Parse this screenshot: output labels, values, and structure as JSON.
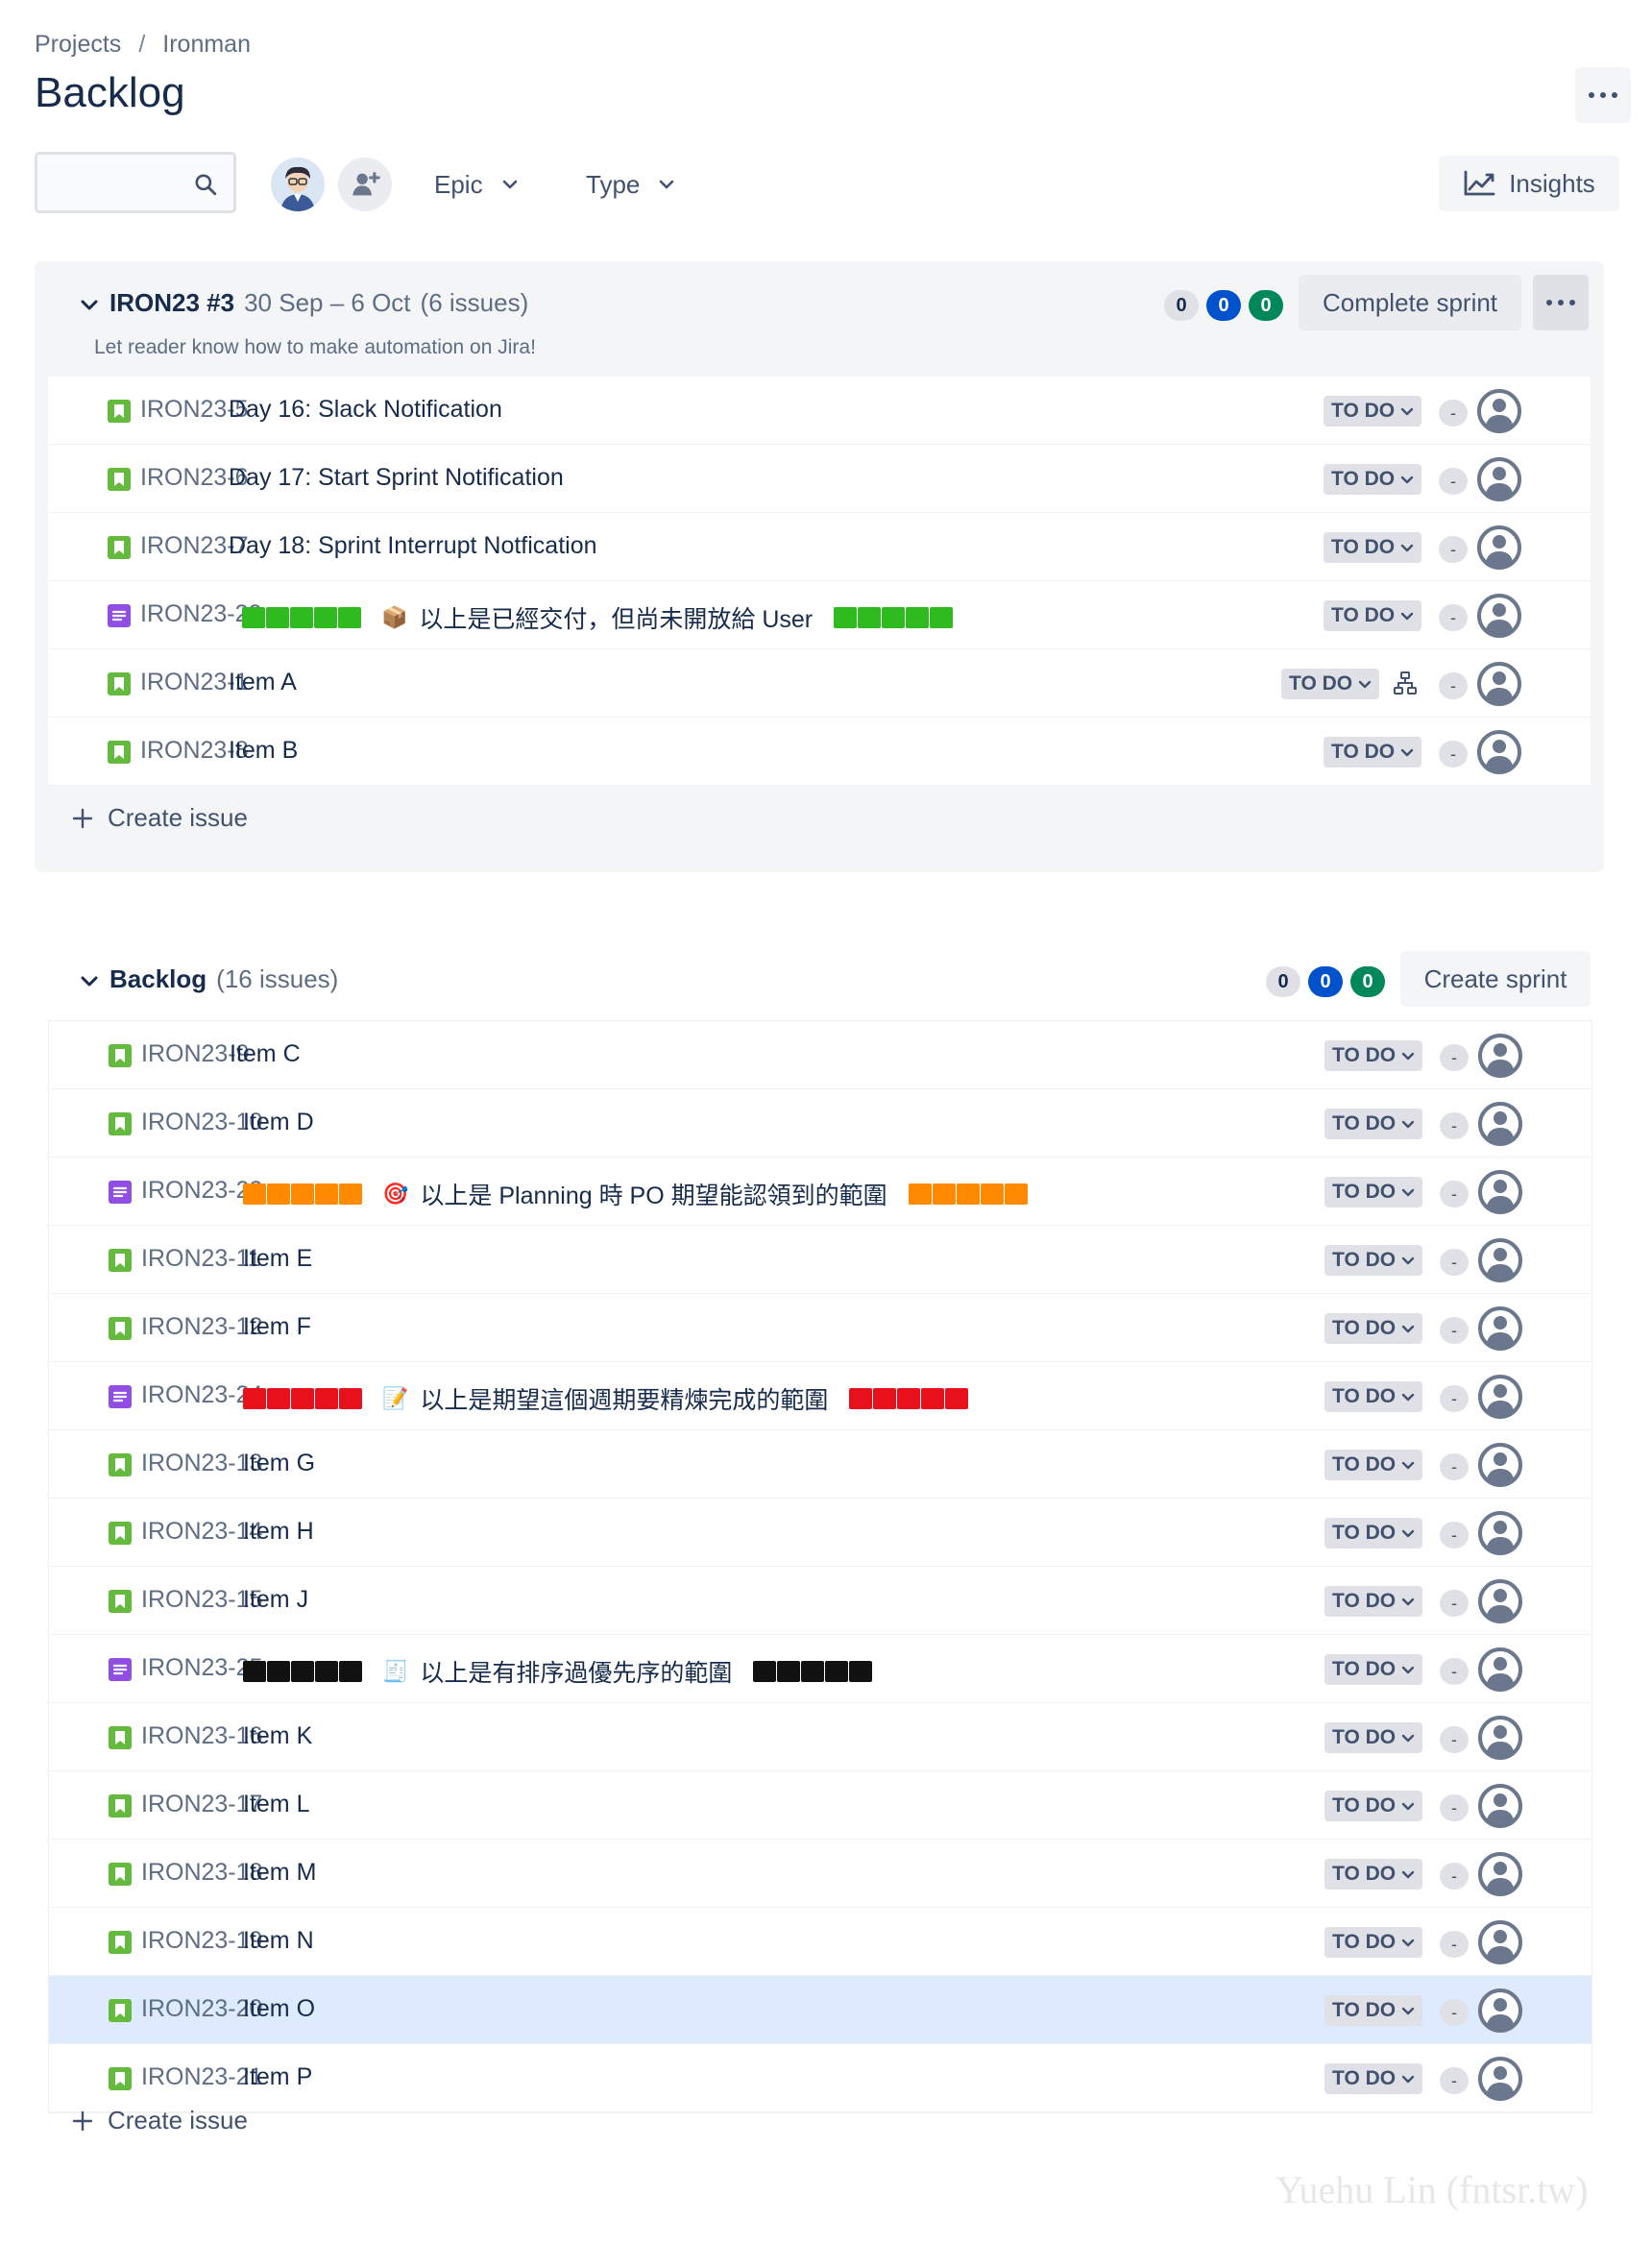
{
  "breadcrumb": {
    "projects": "Projects",
    "separator": "/",
    "project": "Ironman"
  },
  "page": {
    "title": "Backlog"
  },
  "toolbar": {
    "search_placeholder": "",
    "epic_label": "Epic",
    "type_label": "Type",
    "insights_label": "Insights"
  },
  "sprint": {
    "name": "IRON23 #3",
    "dates": "30 Sep – 6 Oct",
    "issue_count": "(6 issues)",
    "goal": "Let reader know how to make automation on Jira!",
    "counts": {
      "todo": "0",
      "in_progress": "0",
      "done": "0"
    },
    "action_label": "Complete sprint",
    "create_label": "Create issue",
    "issues": [
      {
        "key": "IRON23-5",
        "summary": "Day 16: Slack Notification",
        "type": "story",
        "status": "TO DO",
        "estimate": "-"
      },
      {
        "key": "IRON23-6",
        "summary": "Day 17: Start Sprint Notification",
        "type": "story",
        "status": "TO DO",
        "estimate": "-"
      },
      {
        "key": "IRON23-7",
        "summary": "Day 18: Sprint Interrupt Notfication",
        "type": "story",
        "status": "TO DO",
        "estimate": "-"
      },
      {
        "key": "IRON23-22",
        "summary": "以上是已經交付，但尚未開放給 User",
        "type": "task",
        "status": "TO DO",
        "estimate": "-",
        "divider_color": "#2fba1f",
        "glyph": "📦"
      },
      {
        "key": "IRON23-1",
        "summary": "Item A",
        "type": "story",
        "status": "TO DO",
        "estimate": "-",
        "has_children": true
      },
      {
        "key": "IRON23-8",
        "summary": "Item B",
        "type": "story",
        "status": "TO DO",
        "estimate": "-"
      }
    ]
  },
  "backlog": {
    "name": "Backlog",
    "issue_count": "(16 issues)",
    "counts": {
      "todo": "0",
      "in_progress": "0",
      "done": "0"
    },
    "action_label": "Create sprint",
    "create_label": "Create issue",
    "issues": [
      {
        "key": "IRON23-9",
        "summary": "Item C",
        "type": "story",
        "status": "TO DO",
        "estimate": "-"
      },
      {
        "key": "IRON23-10",
        "summary": "Item D",
        "type": "story",
        "status": "TO DO",
        "estimate": "-"
      },
      {
        "key": "IRON23-23",
        "summary": "以上是 Planning 時 PO 期望能認領到的範圍",
        "type": "task",
        "status": "TO DO",
        "estimate": "-",
        "divider_color": "#ff8a00",
        "glyph": "🎯"
      },
      {
        "key": "IRON23-11",
        "summary": "Item E",
        "type": "story",
        "status": "TO DO",
        "estimate": "-"
      },
      {
        "key": "IRON23-12",
        "summary": "Item F",
        "type": "story",
        "status": "TO DO",
        "estimate": "-"
      },
      {
        "key": "IRON23-24",
        "summary": "以上是期望這個週期要精煉完成的範圍",
        "type": "task",
        "status": "TO DO",
        "estimate": "-",
        "divider_color": "#e8101a",
        "glyph": "📝"
      },
      {
        "key": "IRON23-13",
        "summary": "Item G",
        "type": "story",
        "status": "TO DO",
        "estimate": "-"
      },
      {
        "key": "IRON23-14",
        "summary": "Item H",
        "type": "story",
        "status": "TO DO",
        "estimate": "-"
      },
      {
        "key": "IRON23-15",
        "summary": "Item J",
        "type": "story",
        "status": "TO DO",
        "estimate": "-"
      },
      {
        "key": "IRON23-25",
        "summary": "以上是有排序過優先序的範圍",
        "type": "task",
        "status": "TO DO",
        "estimate": "-",
        "divider_color": "#111111",
        "glyph": "🧾"
      },
      {
        "key": "IRON23-16",
        "summary": "Item K",
        "type": "story",
        "status": "TO DO",
        "estimate": "-"
      },
      {
        "key": "IRON23-17",
        "summary": "Item L",
        "type": "story",
        "status": "TO DO",
        "estimate": "-"
      },
      {
        "key": "IRON23-18",
        "summary": "Item M",
        "type": "story",
        "status": "TO DO",
        "estimate": "-"
      },
      {
        "key": "IRON23-19",
        "summary": "Item N",
        "type": "story",
        "status": "TO DO",
        "estimate": "-"
      },
      {
        "key": "IRON23-20",
        "summary": "Item O",
        "type": "story",
        "status": "TO DO",
        "estimate": "-",
        "selected": true
      },
      {
        "key": "IRON23-21",
        "summary": "Item P",
        "type": "story",
        "status": "TO DO",
        "estimate": "-"
      }
    ]
  },
  "watermark": "Yuehu Lin (fntsr.tw)",
  "colors": {
    "story": "#63ba3c",
    "task": "#904ee2",
    "todo_pill": "#dfe1e6",
    "in_progress_pill": "#0052cc",
    "done_pill": "#00875a",
    "selected_row": "#deebff"
  },
  "icons": {
    "story": "bookmark-icon",
    "task": "list-icon",
    "search": "search-icon",
    "assignee": "user-avatar-icon",
    "child": "hierarchy-icon",
    "more": "more-icon",
    "caret": "chevron-down-icon",
    "insights": "chart-line-icon",
    "add_person": "add-person-icon",
    "create": "plus-icon"
  }
}
